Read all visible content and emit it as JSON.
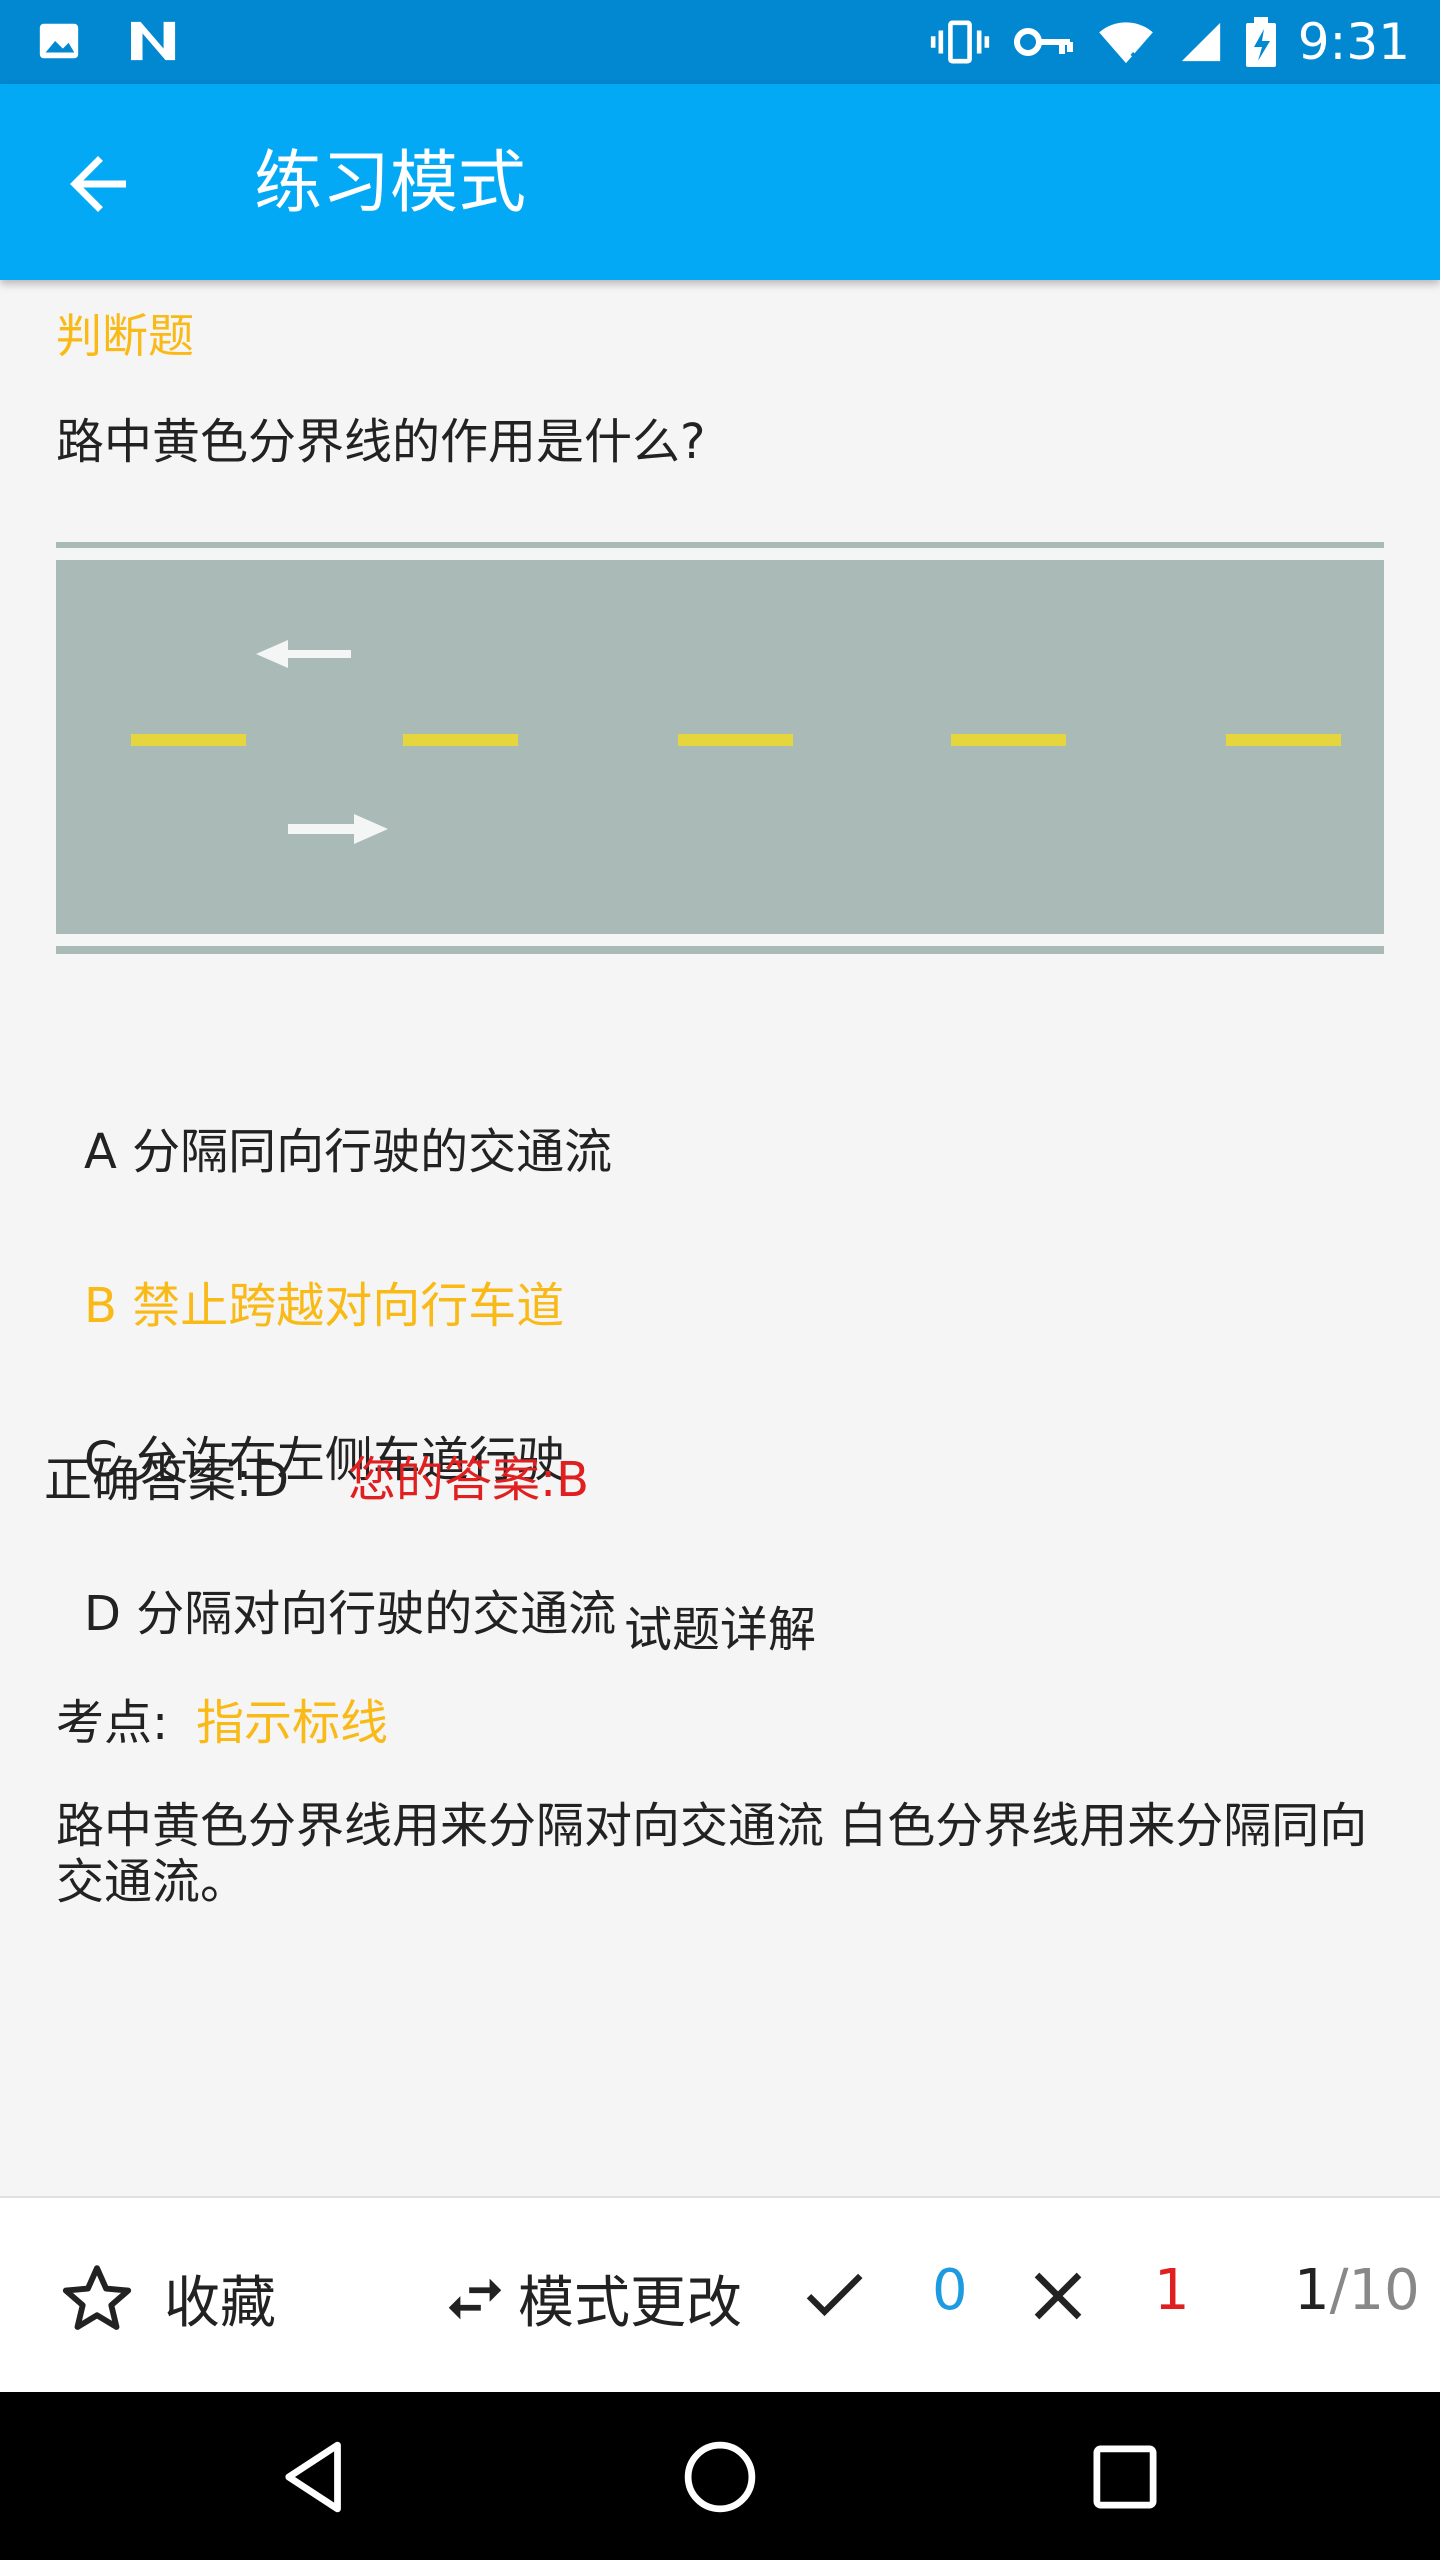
{
  "status_bar": {
    "time": "9:31"
  },
  "app_bar": {
    "title": "练习模式"
  },
  "question": {
    "type": "判断题",
    "text": "路中黄色分界线的作用是什么?"
  },
  "options": [
    {
      "label": "A 分隔同向行驶的交通流",
      "selected": false
    },
    {
      "label": "B 禁止跨越对向行车道",
      "selected": true
    },
    {
      "label": "C 允许在左侧车道行驶",
      "selected": false
    },
    {
      "label": "D 分隔对向行驶的交通流",
      "selected": false
    }
  ],
  "answers": {
    "correct": "正确答案:D",
    "yours": "您的答案:B"
  },
  "detail": {
    "title": "试题详解",
    "point_label": "考点:",
    "point_value": "指示标线",
    "explanation": "路中黄色分界线用来分隔对向交通流 白色分界线用来分隔同向交通流。"
  },
  "bottom_bar": {
    "favorite_label": "收藏",
    "mode_label": "模式更改",
    "correct_count": "0",
    "wrong_count": "1",
    "current": "1",
    "total": "/10"
  },
  "colors": {
    "status_bar": "#0288d1",
    "app_bar": "#03a9f4",
    "accent": "#f9b916",
    "wrong": "#e02020",
    "correct": "#1e9be0"
  },
  "icons": {
    "status_left": [
      "image-icon",
      "n-icon"
    ],
    "status_right": [
      "vibrate-icon",
      "key-icon",
      "wifi-icon",
      "signal-icon",
      "battery-icon"
    ]
  }
}
